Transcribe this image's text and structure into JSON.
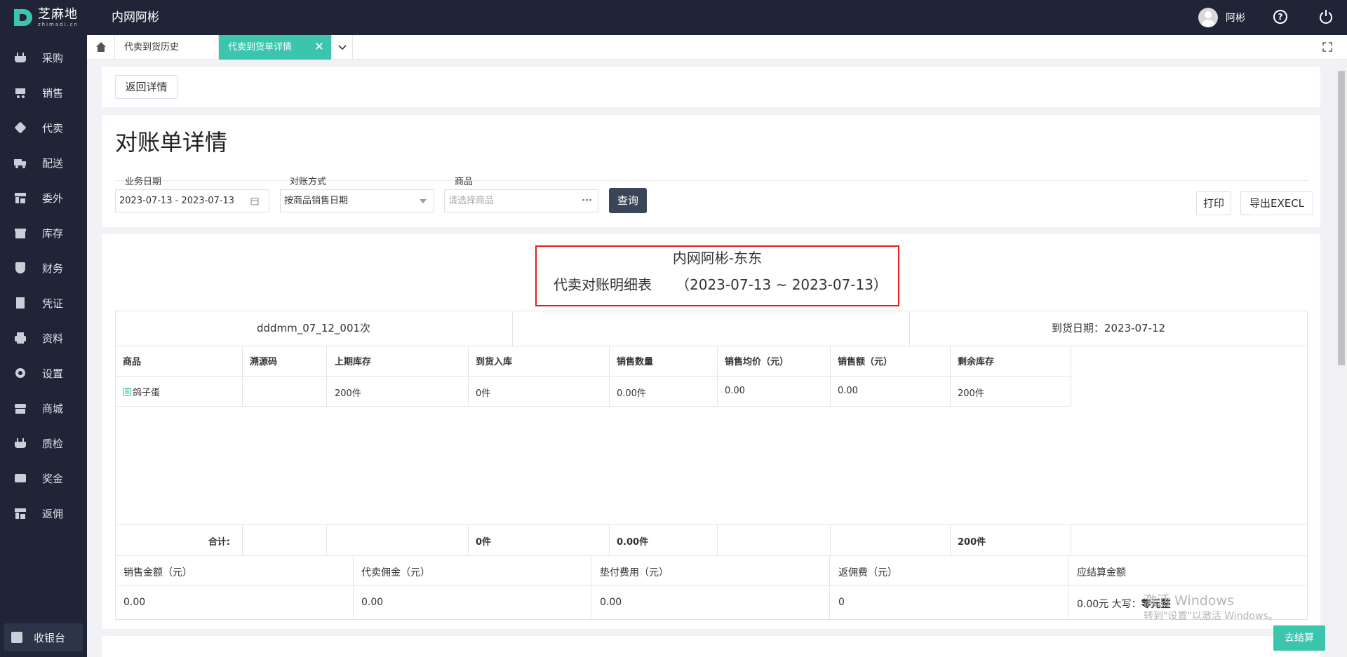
{
  "header": {
    "logo_cn": "芝麻地",
    "logo_en": "zhimadi.cn",
    "system_title": "内网阿彬",
    "user_name": "阿彬"
  },
  "sidebar": {
    "items": [
      {
        "label": "采购",
        "icon": "basket-icon"
      },
      {
        "label": "销售",
        "icon": "cart-icon"
      },
      {
        "label": "代卖",
        "icon": "tag-icon"
      },
      {
        "label": "配送",
        "icon": "truck-icon"
      },
      {
        "label": "委外",
        "icon": "warehouse-icon"
      },
      {
        "label": "库存",
        "icon": "storehouse-icon"
      },
      {
        "label": "财务",
        "icon": "yen-shield-icon"
      },
      {
        "label": "凭证",
        "icon": "voucher-icon"
      },
      {
        "label": "资料",
        "icon": "printer-icon"
      },
      {
        "label": "设置",
        "icon": "gear-icon"
      },
      {
        "label": "商城",
        "icon": "store-icon"
      },
      {
        "label": "质检",
        "icon": "basket-check-icon"
      },
      {
        "label": "奖金",
        "icon": "wallet-icon"
      },
      {
        "label": "返佣",
        "icon": "building-icon"
      }
    ],
    "cashier_label": "收银台"
  },
  "tabs": [
    {
      "label": "代卖到货历史",
      "active": false
    },
    {
      "label": "代卖到货单详情",
      "active": true
    }
  ],
  "actions": {
    "back_label": "返回详情",
    "print_label": "打印",
    "export_label": "导出EXECL",
    "query_label": "查询",
    "checkout_label": "去结算"
  },
  "page": {
    "heading": "对账单详情"
  },
  "filters": {
    "date_label": "业务日期",
    "date_value": "2023-07-13 - 2023-07-13",
    "method_label": "对账方式",
    "method_value": "按商品销售日期",
    "product_label": "商品",
    "product_placeholder": "请选择商品"
  },
  "report": {
    "company": "内网阿彬-东东",
    "title": "代卖对账明细表",
    "date_range": "（2023-07-13 ~ 2023-07-13）",
    "batch": "dddmm_07_12_001次",
    "arrival_date": "到货日期：2023-07-12",
    "columns": [
      "商品",
      "溯源码",
      "上期库存",
      "到货入库",
      "销售数量",
      "销售均价（元）",
      "销售额（元）",
      "剩余库存"
    ],
    "rows": [
      {
        "product": "鸽子蛋",
        "trace": "",
        "prev_stock": "200件",
        "arrival": "0件",
        "qty": "0.00件",
        "avg_price": "0.00",
        "amount": "0.00",
        "remaining": "200件"
      }
    ],
    "totals": {
      "label": "合计:",
      "arrival": "0件",
      "qty": "0.00件",
      "remaining": "200件"
    },
    "summary_headers": [
      "销售金额（元）",
      "代卖佣金（元）",
      "垫付费用（元）",
      "返佣费（元）",
      "应结算金额"
    ],
    "summary_values": [
      "0.00",
      "0.00",
      "0.00",
      "0",
      "0.00元 大写："
    ],
    "summary_uppercase": "零元整"
  },
  "watermark": {
    "line1": "激活 Windows",
    "line2": "转到\"设置\"以激活 Windows。"
  }
}
